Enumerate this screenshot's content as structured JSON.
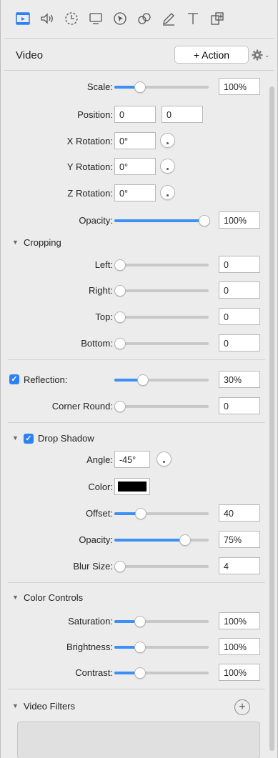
{
  "toolbar": {
    "tools": [
      "video-tab-icon",
      "audio-icon",
      "timing-icon",
      "screen-icon",
      "cursor-icon",
      "animation-icon",
      "annotation-pen-icon",
      "text-icon",
      "layout-icon"
    ]
  },
  "header": {
    "title": "Video",
    "action_label": "+ Action"
  },
  "geometry": {
    "scale_label": "Scale:",
    "scale_value": "100%",
    "scale_fraction": 0.27,
    "position_label": "Position:",
    "position_x": "0",
    "position_y": "0",
    "xrot_label": "X Rotation:",
    "xrot_value": "0°",
    "yrot_label": "Y Rotation:",
    "yrot_value": "0°",
    "zrot_label": "Z Rotation:",
    "zrot_value": "0°",
    "opacity_label": "Opacity:",
    "opacity_value": "100%",
    "opacity_fraction": 1.0
  },
  "cropping": {
    "title": "Cropping",
    "left_label": "Left:",
    "left_value": "0",
    "right_label": "Right:",
    "right_value": "0",
    "top_label": "Top:",
    "top_value": "0",
    "bottom_label": "Bottom:",
    "bottom_value": "0"
  },
  "reflection": {
    "label": "Reflection:",
    "value": "30%",
    "fraction": 0.3,
    "checked": true
  },
  "corner": {
    "label": "Corner Round:",
    "value": "0"
  },
  "shadow": {
    "title": "Drop Shadow",
    "checked": true,
    "angle_label": "Angle:",
    "angle_value": "-45°",
    "color_label": "Color:",
    "color_hex": "#000000",
    "offset_label": "Offset:",
    "offset_value": "40",
    "offset_fraction": 0.28,
    "opacity_label": "Opacity:",
    "opacity_value": "75%",
    "opacity_fraction": 0.75,
    "blur_label": "Blur Size:",
    "blur_value": "4",
    "blur_fraction": 0.04
  },
  "color_controls": {
    "title": "Color Controls",
    "saturation_label": "Saturation:",
    "saturation_value": "100%",
    "brightness_label": "Brightness:",
    "brightness_value": "100%",
    "contrast_label": "Contrast:",
    "contrast_value": "100%"
  },
  "video_filters": {
    "title": "Video Filters"
  },
  "colors": {
    "accent": "#3b8ff5",
    "checkbox": "#2c82f4"
  }
}
